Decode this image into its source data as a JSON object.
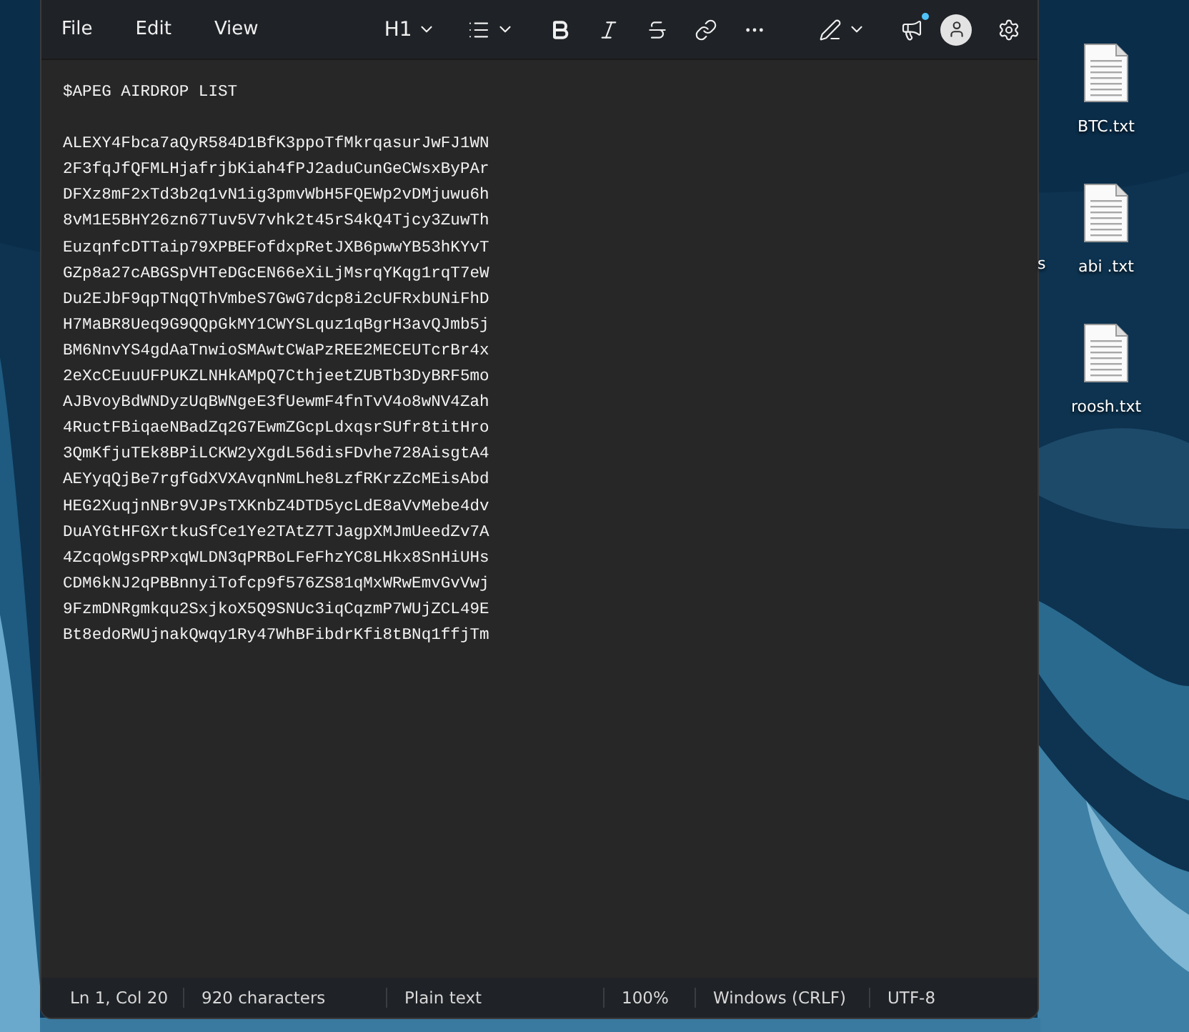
{
  "desktop": {
    "icons": [
      {
        "label": "BTC.txt"
      },
      {
        "label": "abi .txt"
      },
      {
        "label": "roosh.txt"
      }
    ],
    "partial_label": "s"
  },
  "window": {
    "menu": [
      "File",
      "Edit",
      "View"
    ],
    "heading_style": "H1",
    "notification_dot": true
  },
  "document": {
    "title": "$APEG AIRDROP LIST",
    "lines": [
      "ALEXY4Fbca7aQyR584D1BfK3ppoTfMkrqasurJwFJ1WN",
      "2F3fqJfQFMLHjafrjbKiah4fPJ2aduCunGeCWsxByPAr",
      "DFXz8mF2xTd3b2q1vN1ig3pmvWbH5FQEWp2vDMjuwu6h",
      "8vM1E5BHY26zn67Tuv5V7vhk2t45rS4kQ4Tjcy3ZuwTh",
      "EuzqnfcDTTaip79XPBEFofdxpRetJXB6pwwYB53hKYvT",
      "GZp8a27cABGSpVHTeDGcEN66eXiLjMsrqYKqg1rqT7eW",
      "Du2EJbF9qpTNqQThVmbeS7GwG7dcp8i2cUFRxbUNiFhD",
      "H7MaBR8Ueq9G9QQpGkMY1CWYSLquz1qBgrH3avQJmb5j",
      "BM6NnvYS4gdAaTnwioSMAwtCWaPzREE2MECEUTcrBr4x",
      "2eXcCEuuUFPUKZLNHkAMpQ7CthjeetZUBTb3DyBRF5mo",
      "AJBvoyBdWNDyzUqBWNgeE3fUewmF4fnTvV4o8wNV4Zah",
      "4RuctFBiqaeNBadZq2G7EwmZGcpLdxqsrSUfr8titHro",
      "3QmKfjuTEk8BPiLCKW2yXgdL56disFDvhe728AisgtA4",
      "AEYyqQjBe7rgfGdXVXAvqnNmLhe8LzfRKrzZcMEisAbd",
      "HEG2XuqjnNBr9VJPsTXKnbZ4DTD5ycLdE8aVvMebe4dv",
      "DuAYGtHFGXrtkuSfCe1Ye2TAtZ7TJagpXMJmUeedZv7A",
      "4ZcqoWgsPRPxqWLDN3qPRBoLFeFhzYC8LHkx8SnHiUHs",
      "CDM6kNJ2qPBBnnyiTofcp9f576ZS81qMxWRwEmvGvVwj",
      "9FzmDNRgmkqu2SxjkoX5Q9SNUc3iqCqzmP7WUjZCL49E",
      "Bt8edoRWUjnakQwqy1Ry47WhBFibdrKfi8tBNq1ffjTm"
    ]
  },
  "status_bar": [
    "Ln 1, Col 20",
    "920 characters",
    "Plain text",
    "100%",
    "Windows (CRLF)",
    "UTF-8"
  ]
}
